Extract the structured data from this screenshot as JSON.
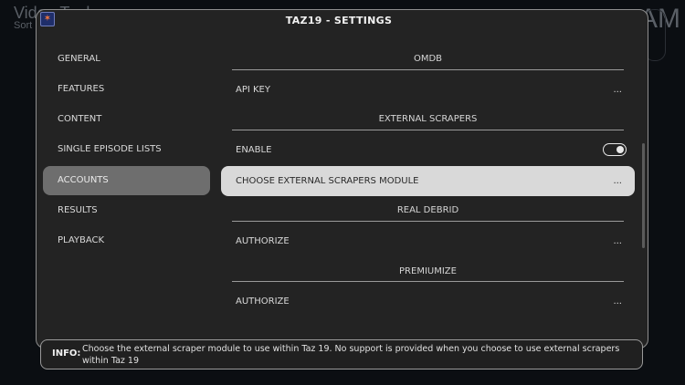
{
  "background": {
    "title": "Video Tools",
    "subtitle": "Sort",
    "right_text": "AM"
  },
  "dialog": {
    "title": "TAZ19 - SETTINGS"
  },
  "sidebar": {
    "items": [
      {
        "label": "GENERAL"
      },
      {
        "label": "FEATURES"
      },
      {
        "label": "CONTENT"
      },
      {
        "label": "SINGLE EPISODE LISTS"
      },
      {
        "label": "ACCOUNTS",
        "active": true
      },
      {
        "label": "RESULTS"
      },
      {
        "label": "PLAYBACK"
      }
    ]
  },
  "settings": {
    "sections": [
      {
        "title": "OMDB"
      },
      {
        "title": "EXTERNAL SCRAPERS"
      },
      {
        "title": "REAL DEBRID"
      },
      {
        "title": "PREMIUMIZE"
      }
    ],
    "rows": [
      {
        "label": "API KEY",
        "control": "..."
      },
      {
        "label": "ENABLE",
        "toggle_on": true
      },
      {
        "label": "CHOOSE EXTERNAL SCRAPERS MODULE",
        "control": "...",
        "selected": true
      },
      {
        "label": "AUTHORIZE",
        "control": "..."
      },
      {
        "label": "AUTHORIZE",
        "control": "..."
      }
    ]
  },
  "info": {
    "label": "INFO:",
    "text": "Choose the external scraper module to use within Taz 19. No support is provided when you choose to use external scrapers within Taz 19"
  },
  "colors": {
    "dialog_bg": "#232323",
    "selected_row_bg": "#d9d9d9",
    "active_nav_bg": "#6e6e6e"
  }
}
